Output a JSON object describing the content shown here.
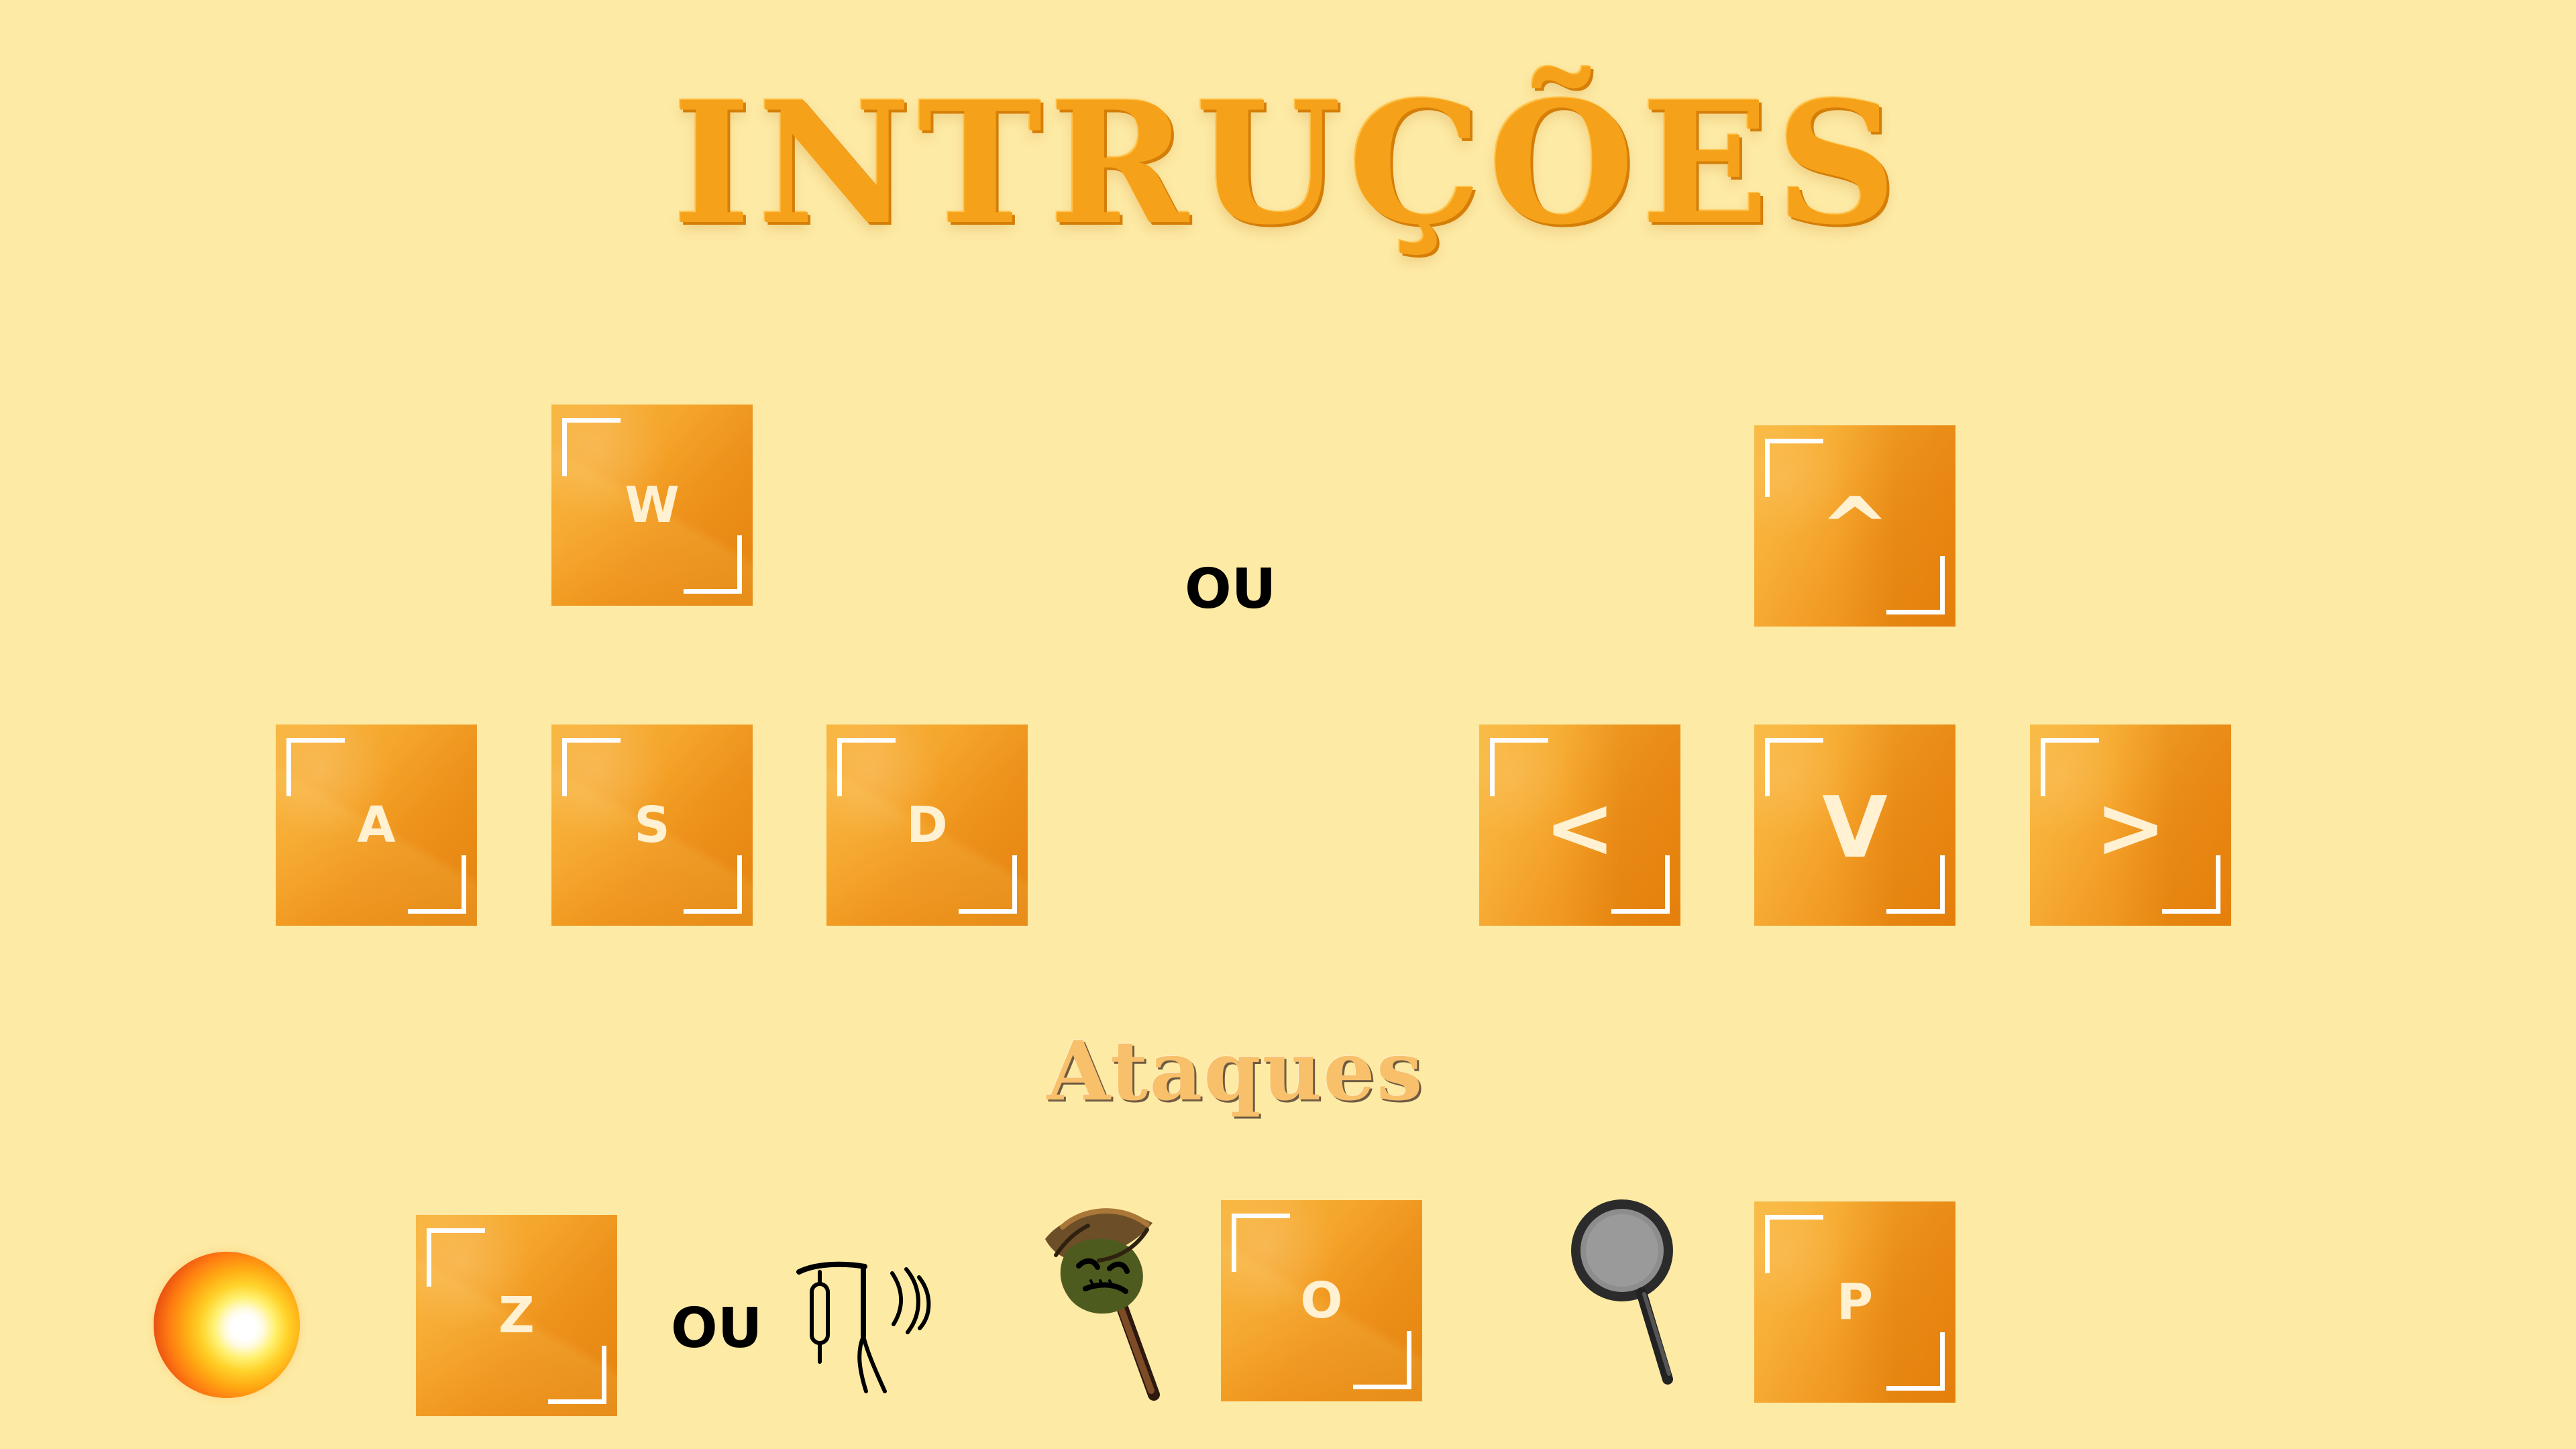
{
  "title": "INTRUÇÕES",
  "separators": {
    "movement": "OU",
    "attack": "OU"
  },
  "sections": {
    "attacks": "Ataques"
  },
  "movement": {
    "wasd": {
      "up": "W",
      "left": "A",
      "down": "S",
      "right": "D"
    },
    "arrows": {
      "up": "^",
      "left": "<",
      "down": "v",
      "right": ">"
    }
  },
  "attacks": {
    "keys": {
      "fire": "Z",
      "scarecrow": "O",
      "pan": "P"
    }
  },
  "icons": {
    "fire": "fireball-icon",
    "hanged": "hanged-figure-icon",
    "scarecrow": "scarecrow-icon",
    "pan": "frying-pan-icon"
  },
  "colors": {
    "background": "#fdeaa4",
    "key_orange": "#f5a21a",
    "title_orange": "#f5a21a",
    "text_black": "#000000",
    "key_text": "#fff1d2"
  }
}
